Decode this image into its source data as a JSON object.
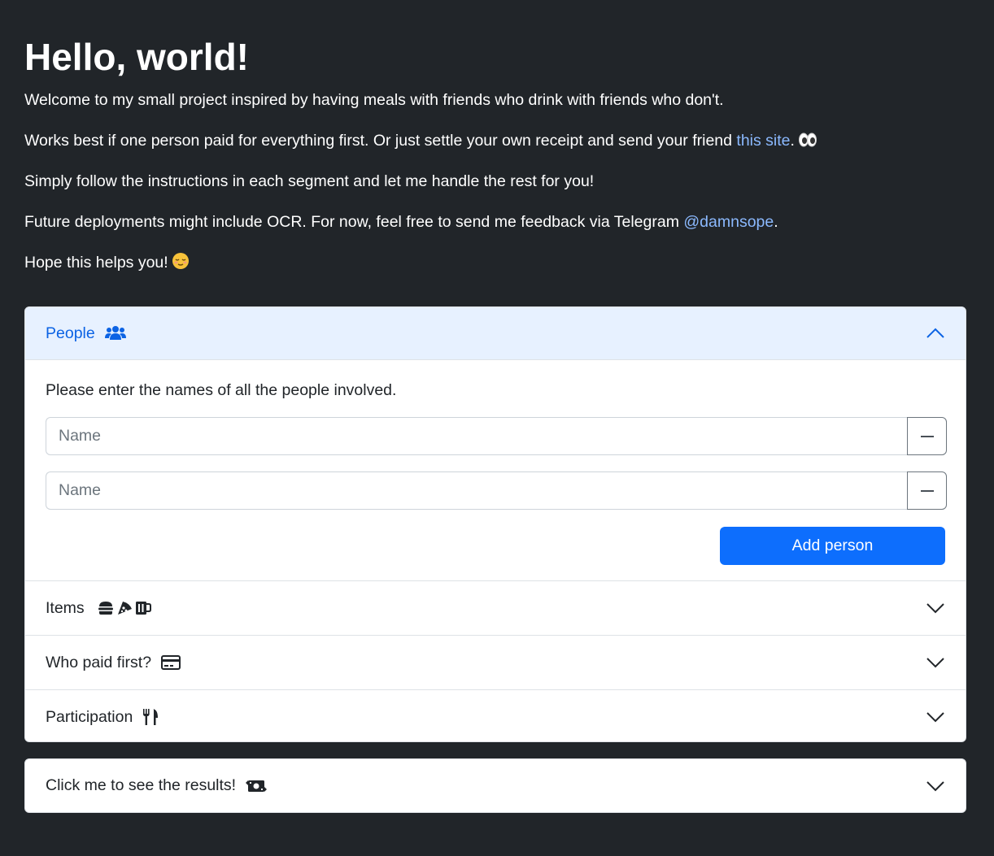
{
  "intro": {
    "heading": "Hello, world!",
    "line1": "Welcome to my small project inspired by having meals with friends who drink with friends who don't.",
    "line2_prefix": "Works best if one person paid for everything first. Or just settle your own receipt and send your friend ",
    "line2_link": "this site",
    "line2_suffix": ".",
    "line2_icon": "eyes-emoji",
    "line3": "Simply follow the instructions in each segment and let me handle the rest for you!",
    "line4_prefix": "Future deployments might include OCR. For now, feel free to send me feedback via Telegram ",
    "line4_link": "@damnsope",
    "line4_suffix": ".",
    "line5": "Hope this helps you!",
    "line5_icon": "relieved-face-emoji"
  },
  "accordion": {
    "people": {
      "title": "People",
      "icon": "users-icon",
      "instruction": "Please enter the names of all the people involved.",
      "inputs": [
        {
          "value": "",
          "placeholder": "Name"
        },
        {
          "value": "",
          "placeholder": "Name"
        }
      ],
      "add_label": "Add person"
    },
    "items": {
      "title": "Items",
      "icons": [
        "burger-icon",
        "pizza-icon",
        "mug-icon"
      ]
    },
    "who_paid": {
      "title": "Who paid first?",
      "icon": "credit-card-icon"
    },
    "participation": {
      "title": "Participation",
      "icon": "utensils-icon"
    }
  },
  "results": {
    "title": "Click me to see the results!",
    "icon": "money-bill-icon"
  },
  "colors": {
    "background": "#212529",
    "link": "#8bb9fe",
    "primary": "#0d6efd",
    "active_header_bg": "#e7f1ff",
    "active_header_text": "#0c63e4"
  }
}
